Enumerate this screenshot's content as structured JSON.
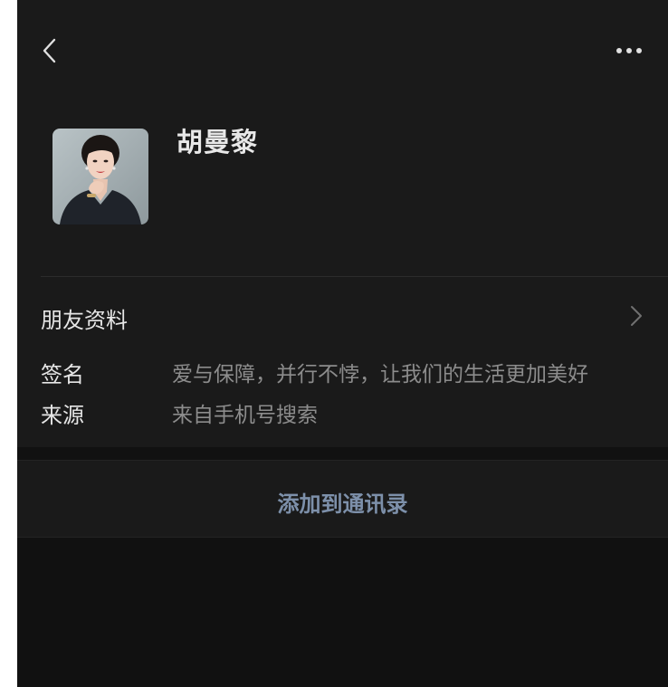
{
  "header": {
    "back_icon": "chevron-left-icon",
    "more_icon": "more-dots-icon"
  },
  "profile": {
    "name": "胡曼黎",
    "avatar_icon": "profile-photo"
  },
  "friend_info": {
    "label": "朋友资料",
    "chevron_icon": "chevron-right-icon"
  },
  "details": [
    {
      "label": "签名",
      "value": "爱与保障，并行不悖，让我们的生活更加美好"
    },
    {
      "label": "来源",
      "value": "来自手机号搜索"
    }
  ],
  "actions": {
    "add_contact_label": "添加到通讯录"
  },
  "colors": {
    "background": "#111111",
    "card": "#1a1a1a",
    "primary_text": "#e6e6e6",
    "secondary_text": "#8c8c8c",
    "link_text": "#7d90aa"
  }
}
